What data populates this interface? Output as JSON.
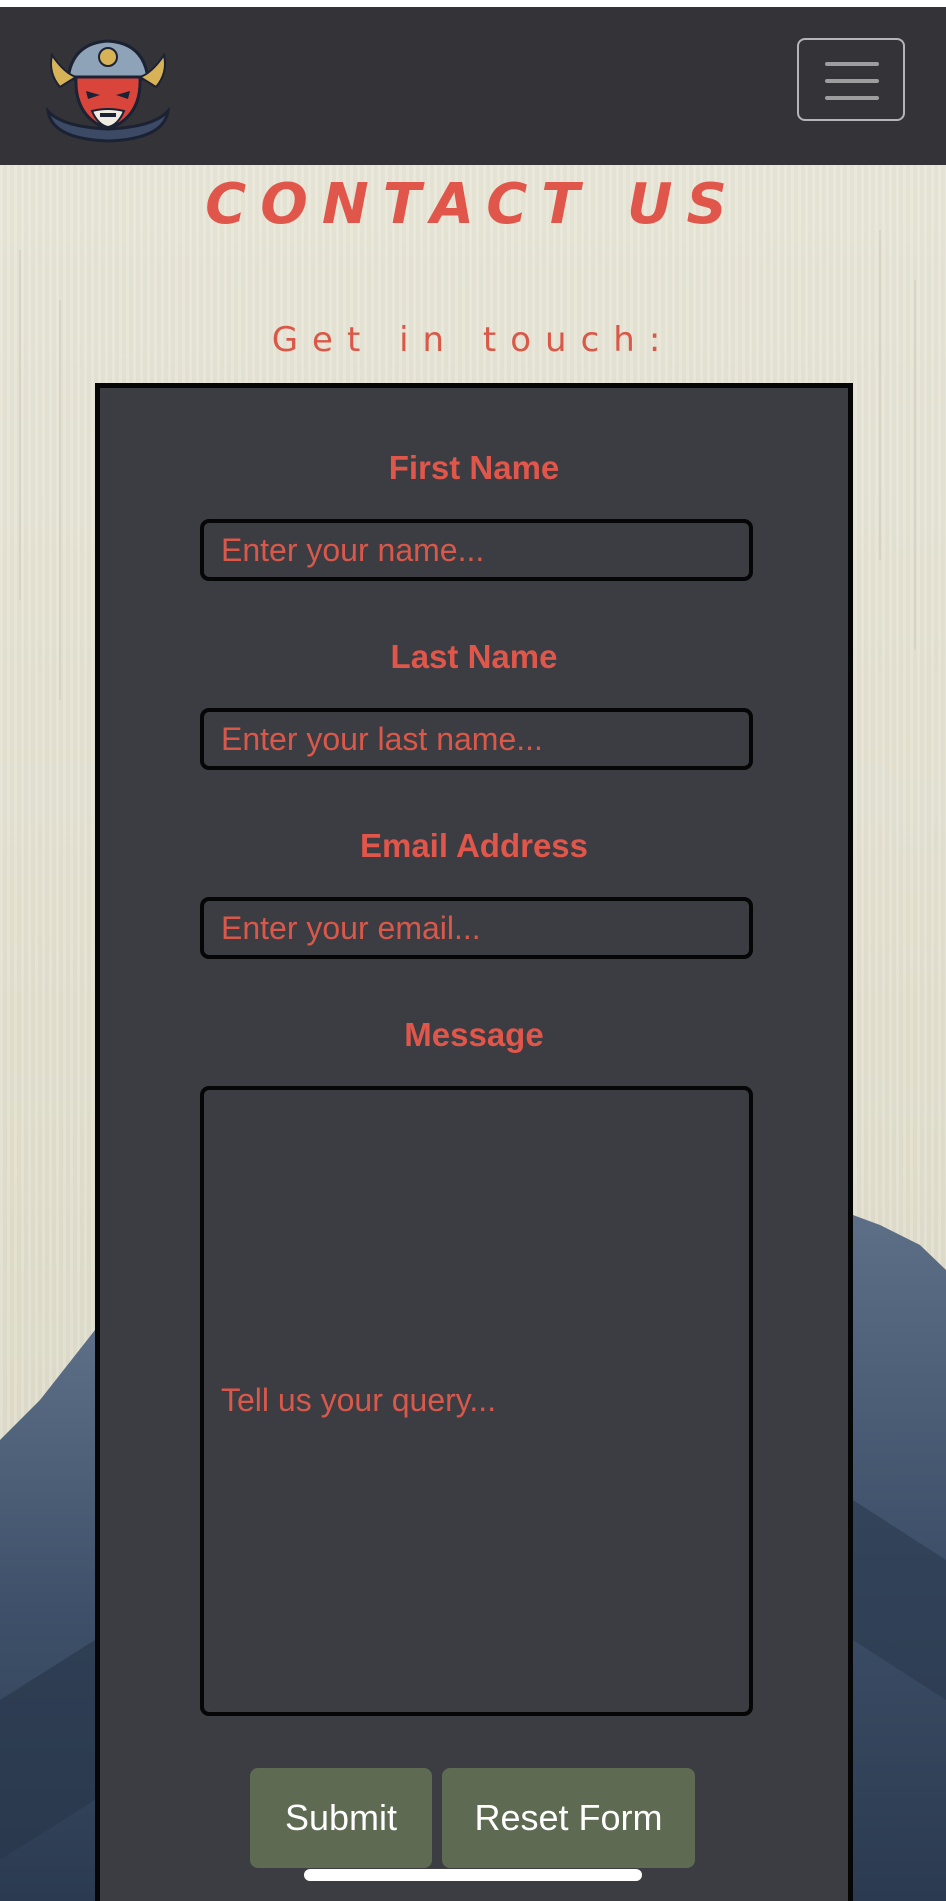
{
  "header": {
    "logo_icon": "samurai-mask-logo",
    "menu_icon": "hamburger-menu-icon"
  },
  "page": {
    "title": "Contact Us",
    "subtitle": "Get in touch:"
  },
  "form": {
    "first_name": {
      "label": "First Name",
      "placeholder": "Enter your name..."
    },
    "last_name": {
      "label": "Last Name",
      "placeholder": "Enter your last name..."
    },
    "email": {
      "label": "Email Address",
      "placeholder": "Enter your email..."
    },
    "message": {
      "label": "Message",
      "placeholder": "Tell us your query..."
    },
    "submit_label": "Submit",
    "reset_label": "Reset Form"
  },
  "colors": {
    "accent": "#e0564a",
    "navbar": "#343338",
    "card": "#3b3d43",
    "button": "#5e6b52"
  }
}
